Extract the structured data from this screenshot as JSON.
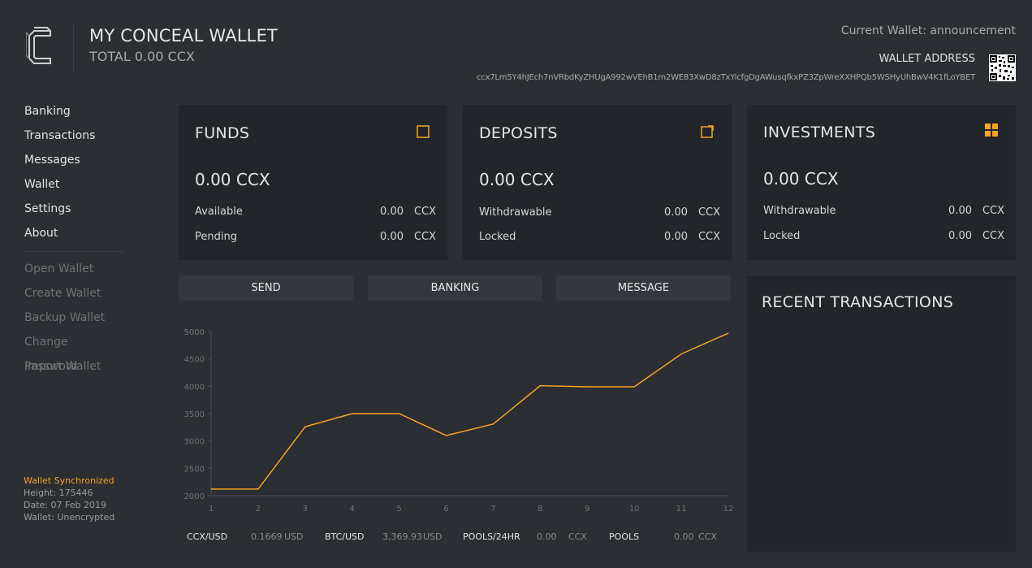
{
  "header": {
    "title": "MY CONCEAL WALLET",
    "total": "TOTAL 0.00 CCX",
    "current_wallet": "Current Wallet: announcement",
    "address_label": "WALLET ADDRESS",
    "address": "ccx7Lm5Y4hJEch7nVRbdKyZHUgA992wVEhB1m2WE83XwD8zTxYicfgDgAWusqfkxPZ3ZpWreXXHPQb5WSHyUhBwV4K1fLoYBET"
  },
  "sidebar": {
    "primary": [
      "Banking",
      "Transactions",
      "Messages",
      "Wallet",
      "Settings",
      "About"
    ],
    "secondary": [
      "Open Wallet",
      "Create Wallet",
      "Backup Wallet",
      "Change Password",
      "Import Wallet"
    ]
  },
  "status": {
    "sync": "Wallet Synchronized",
    "height": "Height: 175446",
    "date": "Date: 07 Feb 2019",
    "wallet": "Wallet: Unencrypted"
  },
  "cards": {
    "funds": {
      "title": "FUNDS",
      "amount": "0.00 CCX",
      "rows": [
        {
          "label": "Available",
          "value": "0.00",
          "currency": "CCX"
        },
        {
          "label": "Pending",
          "value": "0.00",
          "currency": "CCX"
        }
      ]
    },
    "deposits": {
      "title": "DEPOSITS",
      "amount": "0.00 CCX",
      "rows": [
        {
          "label": "Withdrawable",
          "value": "0.00",
          "currency": "CCX"
        },
        {
          "label": "Locked",
          "value": "0.00",
          "currency": "CCX"
        }
      ]
    },
    "investments": {
      "title": "INVESTMENTS",
      "amount": "0.00 CCX",
      "rows": [
        {
          "label": "Withdrawable",
          "value": "0.00",
          "currency": "CCX"
        },
        {
          "label": "Locked",
          "value": "0.00",
          "currency": "CCX"
        }
      ]
    }
  },
  "actions": {
    "send": "SEND",
    "banking": "BANKING",
    "message": "MESSAGE"
  },
  "chart_data": {
    "type": "line",
    "x": [
      1,
      2,
      3,
      4,
      5,
      6,
      7,
      8,
      9,
      10,
      11,
      12
    ],
    "values": [
      2120,
      2120,
      3260,
      3500,
      3500,
      3100,
      3310,
      4010,
      3990,
      3990,
      4590,
      4970
    ],
    "ylim": [
      2000,
      5000
    ],
    "yticks": [
      2000,
      2500,
      3000,
      3500,
      4000,
      4500,
      5000
    ],
    "line_color": "#f5a623",
    "grid": false
  },
  "tickers": {
    "ccx_usd": {
      "label": "CCX/USD",
      "value": "0.1669",
      "unit": "USD"
    },
    "btc_usd": {
      "label": "BTC/USD",
      "value": "3,369.93",
      "unit": "USD"
    },
    "pools_24hr": {
      "label": "POOLS/24HR",
      "value": "0.00",
      "unit": "CCX"
    },
    "pools": {
      "label": "POOLS",
      "value": "0.00",
      "unit": "CCX"
    }
  },
  "recent": {
    "title": "RECENT TRANSACTIONS"
  },
  "colors": {
    "accent": "#f5a623",
    "background": "#2b2e33",
    "panel": "#22252a"
  }
}
